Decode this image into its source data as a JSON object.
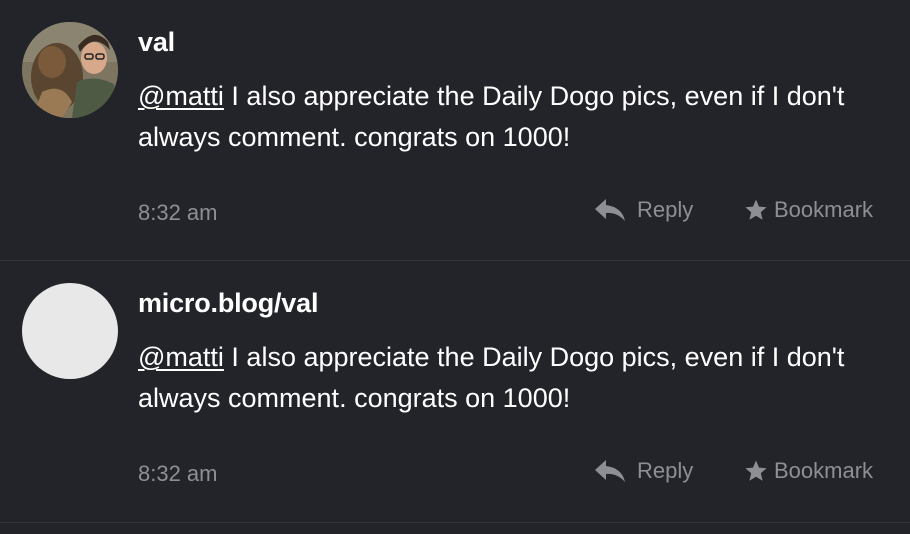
{
  "posts": [
    {
      "username": "val",
      "avatar_type": "photo",
      "mention": "@matti",
      "body": " I also appreciate the Daily Dogo pics, even if I don't always comment. congrats on 1000!",
      "time": "8:32 am",
      "reply_label": "Reply",
      "bookmark_label": "Bookmark"
    },
    {
      "username": "micro.blog/val",
      "avatar_type": "blank",
      "mention": "@matti",
      "body": " I also appreciate the Daily Dogo pics, even if I don't always comment. congrats on 1000!",
      "time": "8:32 am",
      "reply_label": "Reply",
      "bookmark_label": "Bookmark"
    }
  ],
  "icons": {
    "reply": "reply-arrow-icon",
    "bookmark": "star-icon"
  },
  "colors": {
    "background": "#232429",
    "text": "#ffffff",
    "muted": "#8e8f94",
    "divider": "#34353a"
  }
}
